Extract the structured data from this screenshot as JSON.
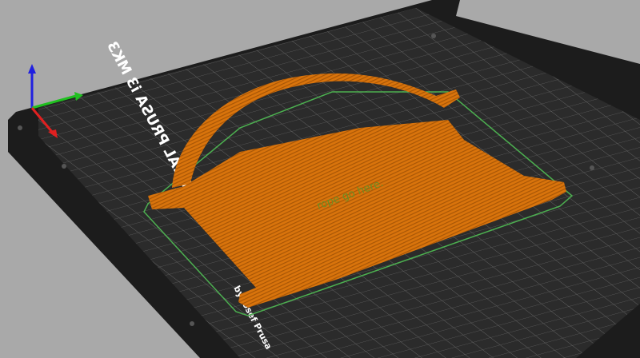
{
  "viewport": {
    "bed_label_line1": "ORIGINAL PRUSA i3 MK3",
    "bed_label_line2": "by Josef Prusa",
    "object_text": "rope go here.",
    "colors": {
      "background": "#a9a9a9",
      "bed": "#1e1e1e",
      "grid": "#3a3a3a",
      "object": "#d9740c",
      "outline": "#4caf50"
    }
  }
}
